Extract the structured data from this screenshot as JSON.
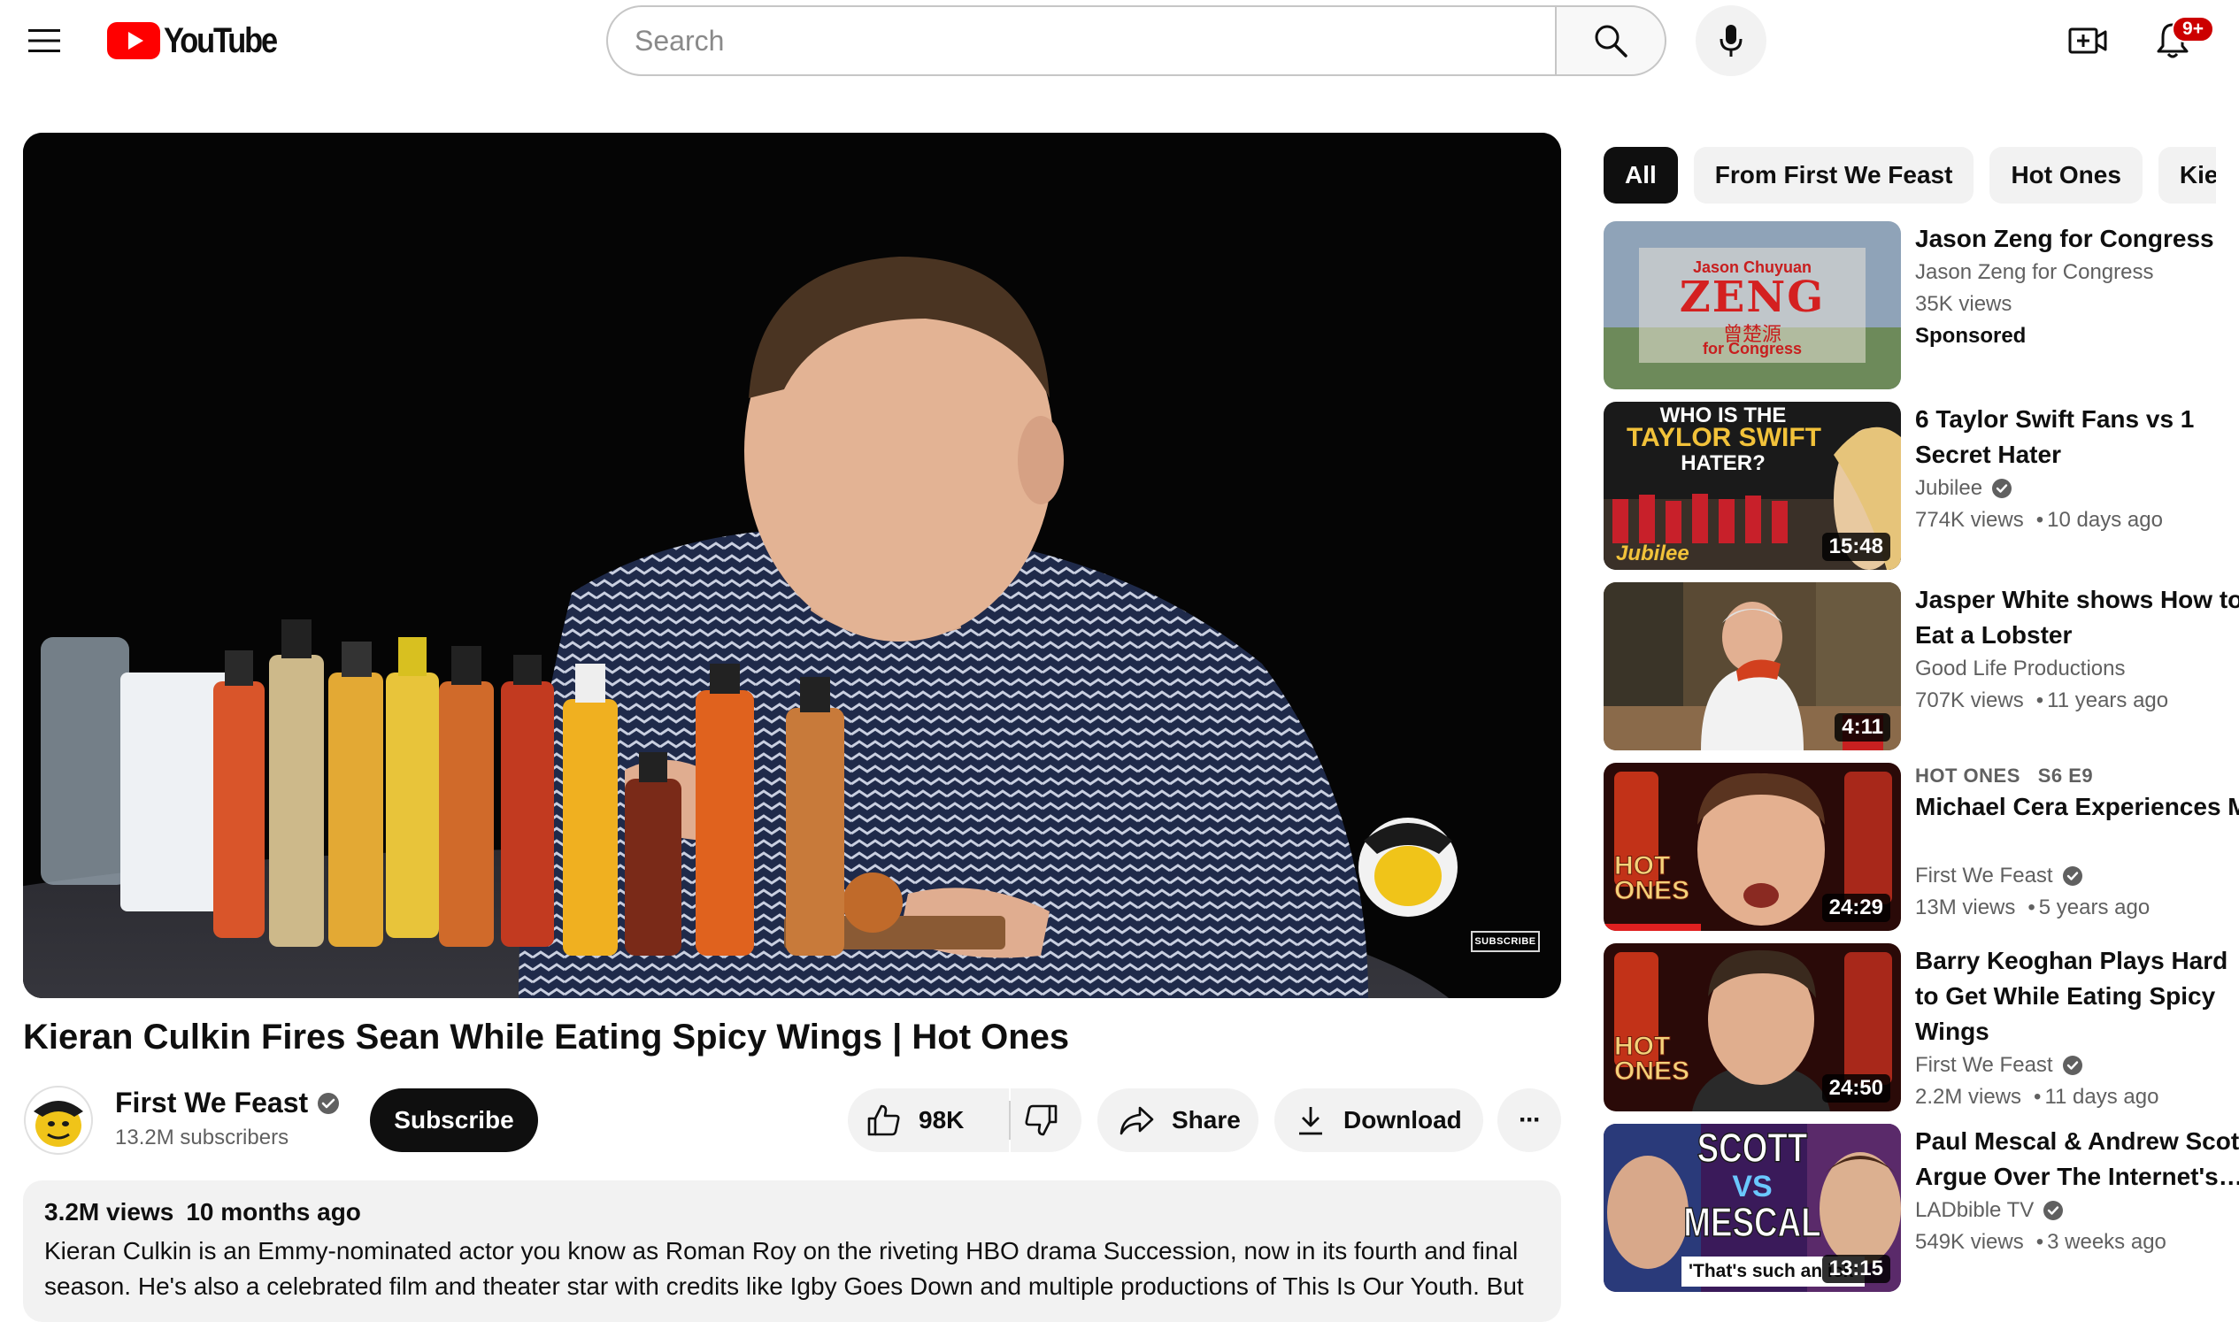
{
  "masthead": {
    "logo_text": "YouTube",
    "search_placeholder": "Search",
    "notification_count": "9+",
    "icons": [
      "menu-icon",
      "youtube-logo-icon",
      "search-icon",
      "mic-icon",
      "create-video-icon",
      "bell-icon"
    ]
  },
  "player": {
    "watermark": "SUBSCRIBE"
  },
  "video": {
    "title": "Kieran Culkin Fires Sean While Eating Spicy Wings | Hot Ones",
    "likes": "98K",
    "share_label": "Share",
    "download_label": "Download",
    "more_label": "···"
  },
  "channel": {
    "name": "First We Feast",
    "subscribers": "13.2M subscribers",
    "subscribe_label": "Subscribe",
    "verified": true
  },
  "description": {
    "views": "3.2M views",
    "age": "10 months ago",
    "text": "Kieran Culkin is an Emmy-nominated actor you know as Roman Roy on the riveting HBO drama Succession, now in its fourth and final season. He's also a celebrated film and theater star with credits like Igby Goes Down and multiple productions of This Is Our Youth. But"
  },
  "chips": [
    {
      "label": "All",
      "active": true
    },
    {
      "label": "From First We Feast",
      "active": false
    },
    {
      "label": "Hot Ones",
      "active": false
    },
    {
      "label": "Kieran",
      "active": false
    }
  ],
  "recommendations": [
    {
      "title": "Jason Zeng for Congress",
      "channel": "Jason Zeng for Congress",
      "views": "35K views",
      "sponsored": "Sponsored",
      "thumb_text_top": "Jason Chuyuan",
      "thumb_text_big": "ZENG",
      "thumb_text_cn": "曾楚源",
      "thumb_text_bottom": "for Congress"
    },
    {
      "title": "6 Taylor Swift Fans vs 1 Secret Hater",
      "channel": "Jubilee",
      "views": "774K views",
      "age": "10 days ago",
      "duration": "15:48",
      "thumb_line1": "WHO IS THE",
      "thumb_line2": "TAYLOR SWIFT",
      "thumb_line3": "HATER?",
      "thumb_brand": "Jubilee"
    },
    {
      "title": "Jasper White shows How to Eat a Lobster",
      "channel": "Good Life Productions",
      "views": "707K views",
      "age": "11 years ago",
      "duration": "4:11"
    },
    {
      "overline": "HOT ONES   S6 E9",
      "title": "Michael Cera Experiences Mouth Pains While Eating Spicy Wings",
      "channel": "First We Feast",
      "views": "13M views",
      "age": "5 years ago",
      "duration": "24:29",
      "thumb_logo1": "HOT",
      "thumb_logo2": "ONES"
    },
    {
      "title": "Barry Keoghan Plays Hard to Get While Eating Spicy Wings",
      "channel": "First We Feast",
      "views": "2.2M views",
      "age": "11 days ago",
      "duration": "24:50",
      "thumb_logo1": "HOT",
      "thumb_logo2": "ONES"
    },
    {
      "title": "Paul Mescal & Andrew Scott Argue Over The Internet's…",
      "channel": "LADbible TV",
      "views": "549K views",
      "age": "3 weeks ago",
      "duration": "13:15",
      "thumb_line1": "SCOTT",
      "thumb_line2": "VS",
      "thumb_line3": "MESCAL",
      "thumb_quote": "'That's such an ick'"
    }
  ],
  "colors": {
    "youtube_red": "#ff0000",
    "badge_red": "#cc0000",
    "text_primary": "#0f0f0f",
    "text_secondary": "#606060",
    "chip_bg": "#f2f2f2"
  }
}
